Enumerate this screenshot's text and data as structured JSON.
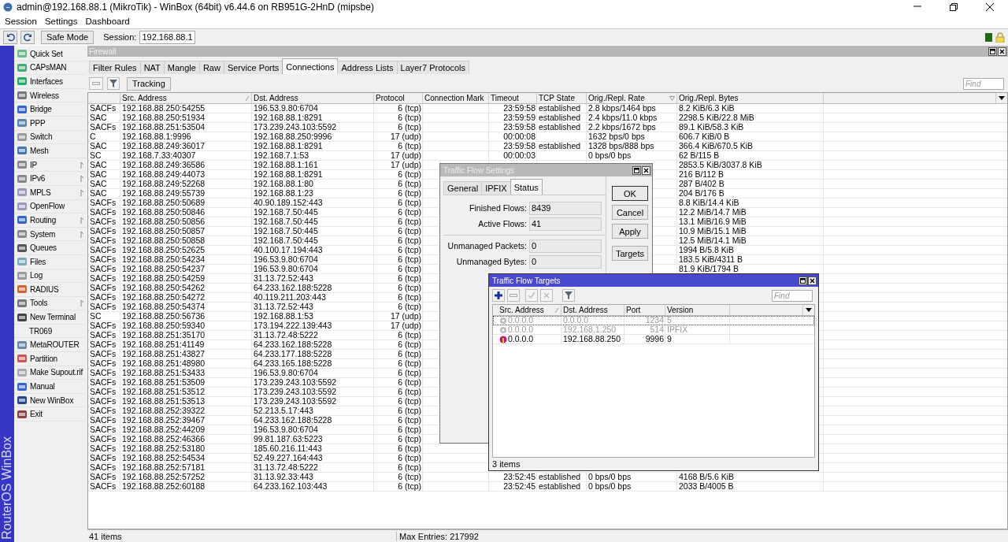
{
  "window": {
    "title": "admin@192.168.88.1 (MikroTik) - WinBox (64bit) v6.44.6 on RB951G-2HnD (mipsbe)"
  },
  "menu": [
    "Session",
    "Settings",
    "Dashboard"
  ],
  "toolbar": {
    "safe_mode": "Safe Mode",
    "session_label": "Session:",
    "session": "192.168.88.1"
  },
  "sidebar": {
    "brand": "RouterOS WinBox",
    "items": [
      {
        "label": "Quick Set",
        "icon": true,
        "submenu": false
      },
      {
        "label": "CAPsMAN",
        "icon": true,
        "submenu": false
      },
      {
        "label": "Interfaces",
        "icon": true,
        "submenu": false
      },
      {
        "label": "Wireless",
        "icon": true,
        "submenu": false
      },
      {
        "label": "Bridge",
        "icon": true,
        "submenu": false
      },
      {
        "label": "PPP",
        "icon": true,
        "submenu": false
      },
      {
        "label": "Switch",
        "icon": true,
        "submenu": false
      },
      {
        "label": "Mesh",
        "icon": true,
        "submenu": false
      },
      {
        "label": "IP",
        "icon": true,
        "submenu": true
      },
      {
        "label": "IPv6",
        "icon": true,
        "submenu": true
      },
      {
        "label": "MPLS",
        "icon": true,
        "submenu": true
      },
      {
        "label": "OpenFlow",
        "icon": true,
        "submenu": false
      },
      {
        "label": "Routing",
        "icon": true,
        "submenu": true
      },
      {
        "label": "System",
        "icon": true,
        "submenu": true
      },
      {
        "label": "Queues",
        "icon": true,
        "submenu": false
      },
      {
        "label": "Files",
        "icon": true,
        "submenu": false
      },
      {
        "label": "Log",
        "icon": true,
        "submenu": false
      },
      {
        "label": "RADIUS",
        "icon": true,
        "submenu": false
      },
      {
        "label": "Tools",
        "icon": true,
        "submenu": true
      },
      {
        "label": "New Terminal",
        "icon": true,
        "submenu": false
      },
      {
        "label": "TR069",
        "icon": false,
        "submenu": false
      },
      {
        "label": "MetaROUTER",
        "icon": true,
        "submenu": false
      },
      {
        "label": "Partition",
        "icon": true,
        "submenu": false
      },
      {
        "label": "Make Supout.rif",
        "icon": true,
        "submenu": false
      },
      {
        "label": "Manual",
        "icon": true,
        "submenu": false
      },
      {
        "label": "New WinBox",
        "icon": true,
        "submenu": false
      },
      {
        "label": "Exit",
        "icon": true,
        "submenu": false
      }
    ]
  },
  "firewall": {
    "title": "Firewall",
    "tabs": [
      {
        "label": "Filter Rules",
        "selected": false
      },
      {
        "label": "NAT",
        "selected": false
      },
      {
        "label": "Mangle",
        "selected": false
      },
      {
        "label": "Raw",
        "selected": false
      },
      {
        "label": "Service Ports",
        "selected": false
      },
      {
        "label": "Connections",
        "selected": true
      },
      {
        "label": "Address Lists",
        "selected": false
      },
      {
        "label": "Layer7 Protocols",
        "selected": false
      }
    ],
    "tracking": "Tracking",
    "find_placeholder": "Find",
    "columns": [
      "Src. Address",
      "Dst. Address",
      "Protocol",
      "Connection Mark",
      "Timeout",
      "TCP State",
      "Orig./Repl. Rate",
      "Orig./Repl. Bytes"
    ],
    "rows": [
      {
        "flags": "SACFs",
        "src": "192.168.88.250:54255",
        "dst": "196.53.9.80:6704",
        "protocol": "6 (tcp)",
        "timeout": "23:59:58",
        "tcp_state": "established",
        "rate": "2.8 kbps/1464 bps",
        "bytes": "8.2 KiB/6.3 KiB"
      },
      {
        "flags": "SAC",
        "src": "192.168.88.250:51934",
        "dst": "192.168.88.1:8291",
        "protocol": "6 (tcp)",
        "timeout": "23:59:59",
        "tcp_state": "established",
        "rate": "2.4 kbps/11.0 kbps",
        "bytes": "2298.5 KiB/22.8 MiB"
      },
      {
        "flags": "SACFs",
        "src": "192.168.88.251:53504",
        "dst": "173.239.243.103:5592",
        "protocol": "6 (tcp)",
        "timeout": "23:59:58",
        "tcp_state": "established",
        "rate": "2.2 kbps/1672 bps",
        "bytes": "89.1 KiB/58.3 KiB"
      },
      {
        "flags": "C",
        "src": "192.168.88.1:9996",
        "dst": "192.168.88.250:9996",
        "protocol": "17 (udp)",
        "timeout": "00:00:08",
        "rate": "1632 bps/0 bps",
        "bytes": "606.7 KiB/0 B"
      },
      {
        "flags": "SAC",
        "src": "192.168.88.249:36017",
        "dst": "192.168.88.1:8291",
        "protocol": "6 (tcp)",
        "timeout": "23:59:58",
        "tcp_state": "established",
        "rate": "1328 bps/888 bps",
        "bytes": "366.4 KiB/670.5 KiB"
      },
      {
        "flags": "SC",
        "src": "192.168.7.33:40307",
        "dst": "192.168.7.1:53",
        "protocol": "17 (udp)",
        "timeout": "00:00:03",
        "rate": "0 bps/0 bps",
        "bytes": "62 B/115 B"
      },
      {
        "flags": "SAC",
        "src": "192.168.88.249:36586",
        "dst": "192.168.88.1:161",
        "protocol": "17 (udp)",
        "bytes": "2853.5 KiB/3037.8 KiB"
      },
      {
        "flags": "SAC",
        "src": "192.168.88.249:44073",
        "dst": "192.168.88.1:8291",
        "protocol": "6 (tcp)",
        "bytes": "216 B/112 B"
      },
      {
        "flags": "SAC",
        "src": "192.168.88.249:52268",
        "dst": "192.168.88.1:80",
        "protocol": "6 (tcp)",
        "bytes": "287 B/402 B"
      },
      {
        "flags": "SAC",
        "src": "192.168.88.249:55739",
        "dst": "192.168.88.1:23",
        "protocol": "6 (tcp)",
        "bytes": "204 B/176 B"
      },
      {
        "flags": "SACFs",
        "src": "192.168.88.250:50689",
        "dst": "40.90.189.152:443",
        "protocol": "6 (tcp)",
        "bytes": "8.8 KiB/14.4 KiB"
      },
      {
        "flags": "SACFs",
        "src": "192.168.88.250:50846",
        "dst": "192.168.7.50:445",
        "protocol": "6 (tcp)",
        "bytes": "12.2 MiB/14.7 MiB"
      },
      {
        "flags": "SACFs",
        "src": "192.168.88.250:50856",
        "dst": "192.168.7.50:445",
        "protocol": "6 (tcp)",
        "bytes": "13.1 MiB/16.9 MiB"
      },
      {
        "flags": "SACFs",
        "src": "192.168.88.250:50857",
        "dst": "192.168.7.50:445",
        "protocol": "6 (tcp)",
        "bytes": "10.9 MiB/15.1 MiB"
      },
      {
        "flags": "SACFs",
        "src": "192.168.88.250:50858",
        "dst": "192.168.7.50:445",
        "protocol": "6 (tcp)",
        "bytes": "12.5 MiB/14.1 MiB"
      },
      {
        "flags": "SACFs",
        "src": "192.168.88.250:52625",
        "dst": "40.100.17.194:443",
        "protocol": "6 (tcp)",
        "bytes": "1994 B/5.8 KiB"
      },
      {
        "flags": "SACFs",
        "src": "192.168.88.250:54234",
        "dst": "196.53.9.80:6704",
        "protocol": "6 (tcp)",
        "bytes": "183.5 KiB/4311 B"
      },
      {
        "flags": "SACFs",
        "src": "192.168.88.250:54237",
        "dst": "196.53.9.80:6704",
        "protocol": "6 (tcp)",
        "bytes": "81.9 KiB/1794 B"
      },
      {
        "flags": "SACFs",
        "src": "192.168.88.250:54259",
        "dst": "31.13.72.52:443",
        "protocol": "6 (tcp)"
      },
      {
        "flags": "SACFs",
        "src": "192.168.88.250:54262",
        "dst": "64.233.162.188:5228",
        "protocol": "6 (tcp)"
      },
      {
        "flags": "SACFs",
        "src": "192.168.88.250:54272",
        "dst": "40.119.211.203:443",
        "protocol": "6 (tcp)"
      },
      {
        "flags": "SACFs",
        "src": "192.168.88.250:54374",
        "dst": "31.13.72.52:443",
        "protocol": "6 (tcp)"
      },
      {
        "flags": "SC",
        "src": "192.168.88.250:56736",
        "dst": "192.168.88.1:53",
        "protocol": "17 (udp)"
      },
      {
        "flags": "SACFs",
        "src": "192.168.88.250:59340",
        "dst": "173.194.222.139:443",
        "protocol": "17 (udp)"
      },
      {
        "flags": "SACFs",
        "src": "192.168.88.251:35170",
        "dst": "31.13.72.48:5222",
        "protocol": "6 (tcp)"
      },
      {
        "flags": "SACFs",
        "src": "192.168.88.251:41149",
        "dst": "64.233.162.188:5228",
        "protocol": "6 (tcp)"
      },
      {
        "flags": "SACFs",
        "src": "192.168.88.251:43827",
        "dst": "64.233.177.188:5228",
        "protocol": "6 (tcp)"
      },
      {
        "flags": "SACFs",
        "src": "192.168.88.251:48980",
        "dst": "64.233.165.188:5228",
        "protocol": "6 (tcp)"
      },
      {
        "flags": "SACFs",
        "src": "192.168.88.251:53433",
        "dst": "196.53.9.80:6704",
        "protocol": "6 (tcp)"
      },
      {
        "flags": "SACFs",
        "src": "192.168.88.251:53509",
        "dst": "173.239.243.103:5592",
        "protocol": "6 (tcp)"
      },
      {
        "flags": "SACFs",
        "src": "192.168.88.251:53512",
        "dst": "173.239.243.103:5592",
        "protocol": "6 (tcp)"
      },
      {
        "flags": "SACFs",
        "src": "192.168.88.251:53513",
        "dst": "173.239.243.103:5592",
        "protocol": "6 (tcp)"
      },
      {
        "flags": "SACFs",
        "src": "192.168.88.252:39322",
        "dst": "52.213.5.17:443",
        "protocol": "6 (tcp)"
      },
      {
        "flags": "SACFs",
        "src": "192.168.88.252:39467",
        "dst": "64.233.162.188:5228",
        "protocol": "6 (tcp)"
      },
      {
        "flags": "SACFs",
        "src": "192.168.88.252:44209",
        "dst": "196.53.9.80:6704",
        "protocol": "6 (tcp)"
      },
      {
        "flags": "SACFs",
        "src": "192.168.88.252:46366",
        "dst": "99.81.187.63:5223",
        "protocol": "6 (tcp)"
      },
      {
        "flags": "SACFs",
        "src": "192.168.88.252:53180",
        "dst": "185.60.216.11:443",
        "protocol": "6 (tcp)"
      },
      {
        "flags": "SACFs",
        "src": "192.168.88.252:54534",
        "dst": "52.49.227.164:443",
        "protocol": "6 (tcp)"
      },
      {
        "flags": "SACFs",
        "src": "192.168.88.252:57181",
        "dst": "31.13.72.48:5222",
        "protocol": "6 (tcp)"
      },
      {
        "flags": "SACFs",
        "src": "192.168.88.252:57252",
        "dst": "31.13.92.33:443",
        "protocol": "6 (tcp)",
        "timeout": "23:52:45",
        "tcp_state": "established",
        "rate": "0 bps/0 bps",
        "bytes": "4168 B/5.6 KiB"
      },
      {
        "flags": "SACFs",
        "src": "192.168.88.252:60188",
        "dst": "64.233.162.103:443",
        "protocol": "6 (tcp)",
        "timeout": "23:52:45",
        "tcp_state": "established",
        "rate": "0 bps/0 bps",
        "bytes": "2033 B/4005 B"
      }
    ],
    "status": "41 items",
    "max_entries": "Max Entries: 217992"
  },
  "settings_dialog": {
    "title": "Traffic Flow Settings",
    "tabs": [
      {
        "label": "General",
        "selected": false
      },
      {
        "label": "IPFIX",
        "selected": false
      },
      {
        "label": "Status",
        "selected": true
      }
    ],
    "field_groups": [
      [
        {
          "label": "Finished Flows:",
          "value": "8439"
        },
        {
          "label": "Active Flows:",
          "value": "41"
        }
      ],
      [
        {
          "label": "Unmanaged Packets:",
          "value": "0"
        },
        {
          "label": "Unmanaged Bytes:",
          "value": "0"
        }
      ]
    ],
    "buttons": [
      "OK",
      "Cancel",
      "Apply",
      "Targets"
    ]
  },
  "targets_dialog": {
    "title": "Traffic Flow Targets",
    "find_placeholder": "Find",
    "columns": [
      "Src. Address",
      "Dst. Address",
      "Port",
      "Version"
    ],
    "rows": [
      {
        "src": "0.0.0.0",
        "dst": "0.0.0.0",
        "port": "1234",
        "version": "5",
        "disabled": true,
        "selected": true
      },
      {
        "src": "0.0.0.0",
        "dst": "192.168.1.250",
        "port": "514",
        "version": "IPFIX",
        "disabled": true,
        "selected": false
      },
      {
        "src": "0.0.0.0",
        "dst": "192.168.88.250",
        "port": "9996",
        "version": "9",
        "disabled": false,
        "selected": false
      }
    ],
    "status": "3 items"
  }
}
